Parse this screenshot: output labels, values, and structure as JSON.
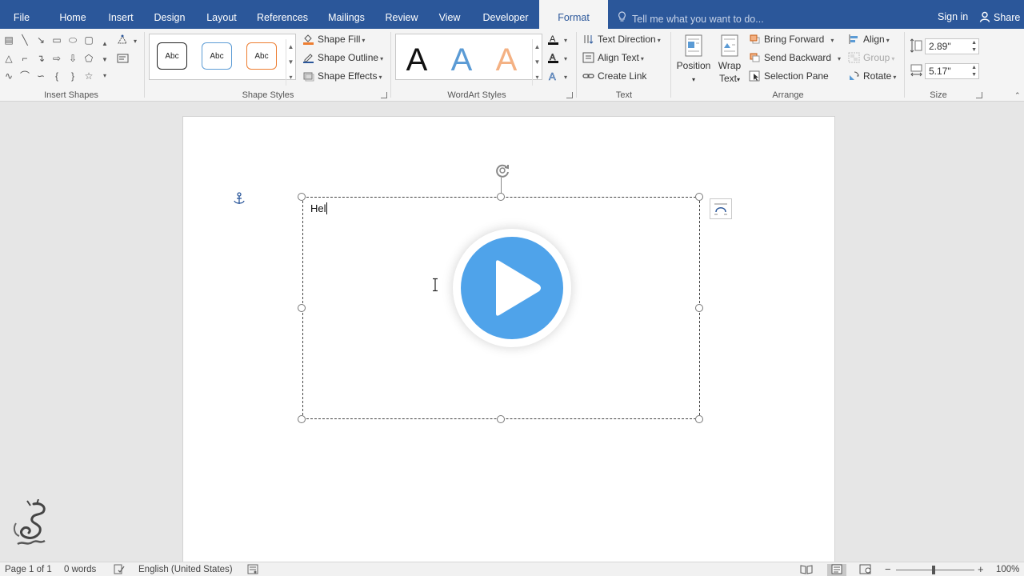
{
  "tabs": [
    {
      "label": "File"
    },
    {
      "label": "Home"
    },
    {
      "label": "Insert"
    },
    {
      "label": "Design"
    },
    {
      "label": "Layout"
    },
    {
      "label": "References"
    },
    {
      "label": "Mailings"
    },
    {
      "label": "Review"
    },
    {
      "label": "View"
    },
    {
      "label": "Developer"
    },
    {
      "label": "Format"
    }
  ],
  "active_tab": "Format",
  "tell_me_placeholder": "Tell me what you want to do...",
  "account": {
    "sign_in": "Sign in",
    "share": "Share"
  },
  "groups": {
    "insert_shapes": "Insert Shapes",
    "shape_styles": "Shape Styles",
    "wordart_styles": "WordArt Styles",
    "text": "Text",
    "arrange": "Arrange",
    "size": "Size"
  },
  "shape_styles": {
    "presets": [
      "Abc",
      "Abc",
      "Abc"
    ],
    "commands": {
      "fill": "Shape Fill",
      "outline": "Shape Outline",
      "effects": "Shape Effects"
    }
  },
  "wordart": {
    "letters": [
      "A",
      "A",
      "A"
    ]
  },
  "text_cmds": {
    "direction": "Text Direction",
    "align": "Align Text",
    "link": "Create Link"
  },
  "arrange": {
    "position": "Position",
    "wrap_line1": "Wrap",
    "wrap_line2": "Text",
    "bring_forward": "Bring Forward",
    "send_backward": "Send Backward",
    "selection_pane": "Selection Pane",
    "align": "Align",
    "group": "Group",
    "rotate": "Rotate"
  },
  "size": {
    "height": "2.89\"",
    "width": "5.17\""
  },
  "document": {
    "textbox_text": "Hel"
  },
  "status": {
    "page": "Page 1 of 1",
    "words": "0 words",
    "language": "English (United States)",
    "zoom": "100%",
    "zoom_level": 1.0
  },
  "colors": {
    "ribbon_blue": "#2b579a",
    "play_blue": "#4fa3ea",
    "wordart_blue": "#5b9bd5",
    "wordart_orange": "#f4b183"
  }
}
